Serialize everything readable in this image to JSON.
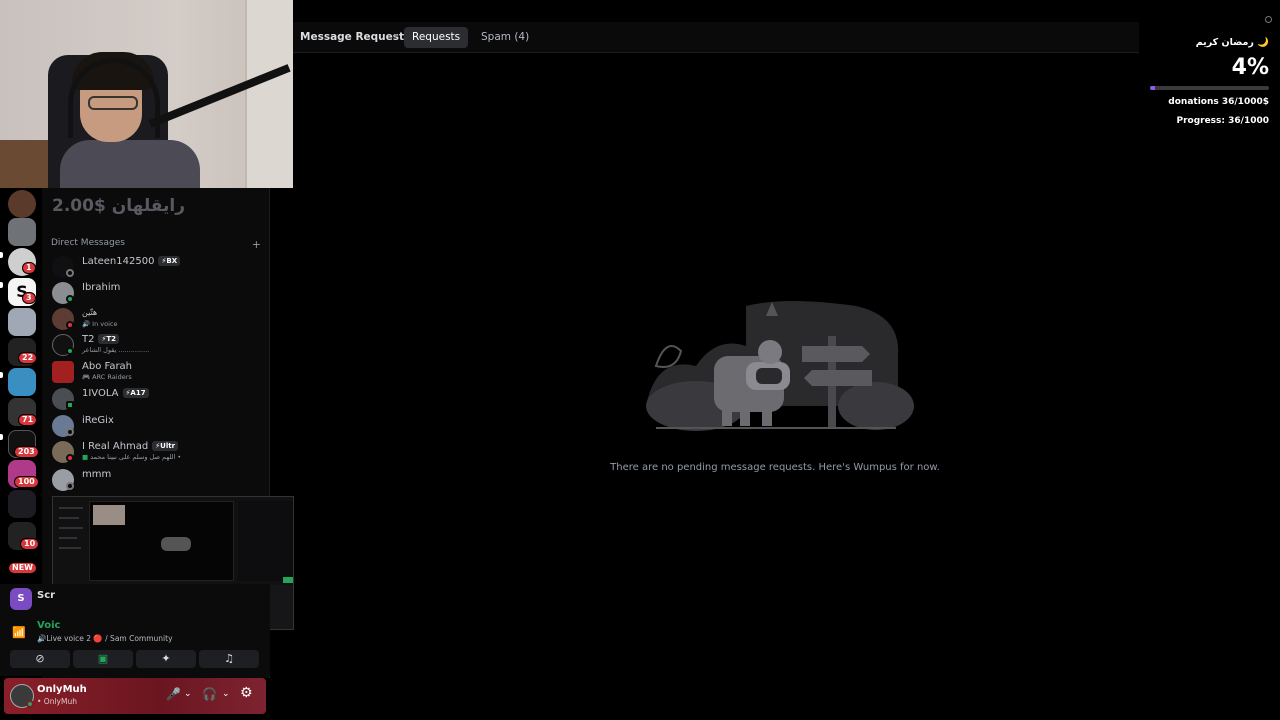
{
  "topbar": {
    "title": "Message Requests",
    "separator": "•",
    "tabs": [
      {
        "label": "Requests",
        "active": true
      },
      {
        "label": "Spam (4)",
        "active": false
      }
    ]
  },
  "main": {
    "empty_text": "There are no pending message requests. Here's Wumpus for now."
  },
  "sidebar": {
    "overlay_text": "2.00$ رايقلهان",
    "dm_header": "Direct Messages",
    "add_symbol": "+",
    "dms": [
      {
        "name": "Lateen142500",
        "tag": "⚡BX",
        "sub": ""
      },
      {
        "name": "Ibrahim",
        "tag": "",
        "sub": ""
      },
      {
        "name": "هتّين",
        "tag": "",
        "sub": "In voice"
      },
      {
        "name": "T2",
        "tag": "⚡T2",
        "sub": "يقول الشاعر ..............."
      },
      {
        "name": "Abo Farah",
        "tag": "",
        "sub": "ARC Raiders"
      },
      {
        "name": "1IVOLA",
        "tag": "⚡A17",
        "sub": ""
      },
      {
        "name": "iReGix",
        "tag": "",
        "sub": ""
      },
      {
        "name": "I Real Ahmad",
        "tag": "⚡Ultr",
        "sub": "اللهم صل وسلم على نبينا محمد •"
      },
      {
        "name": "mmm",
        "tag": "",
        "sub": ""
      }
    ]
  },
  "rail": {
    "badges": [
      "1",
      "3",
      "22",
      "71",
      "203",
      "100",
      "10",
      "NEW"
    ]
  },
  "voice": {
    "screen_label": "Scr",
    "screen_initial": "S",
    "voice_label": "Voic",
    "voice_sub": "🔊Live voice 2 🔴 / Sam Community",
    "controls": [
      "camera-off",
      "share-screen",
      "activities",
      "soundboard"
    ]
  },
  "user": {
    "name": "OnlyMuh",
    "handle": "• OnlyMuh"
  },
  "overlay": {
    "title": "رمضان كريم 🌙",
    "percent": "4%",
    "progress_fraction": 0.036,
    "donations": "donations 36/1000$",
    "progress": "Progress: 36/1000"
  }
}
